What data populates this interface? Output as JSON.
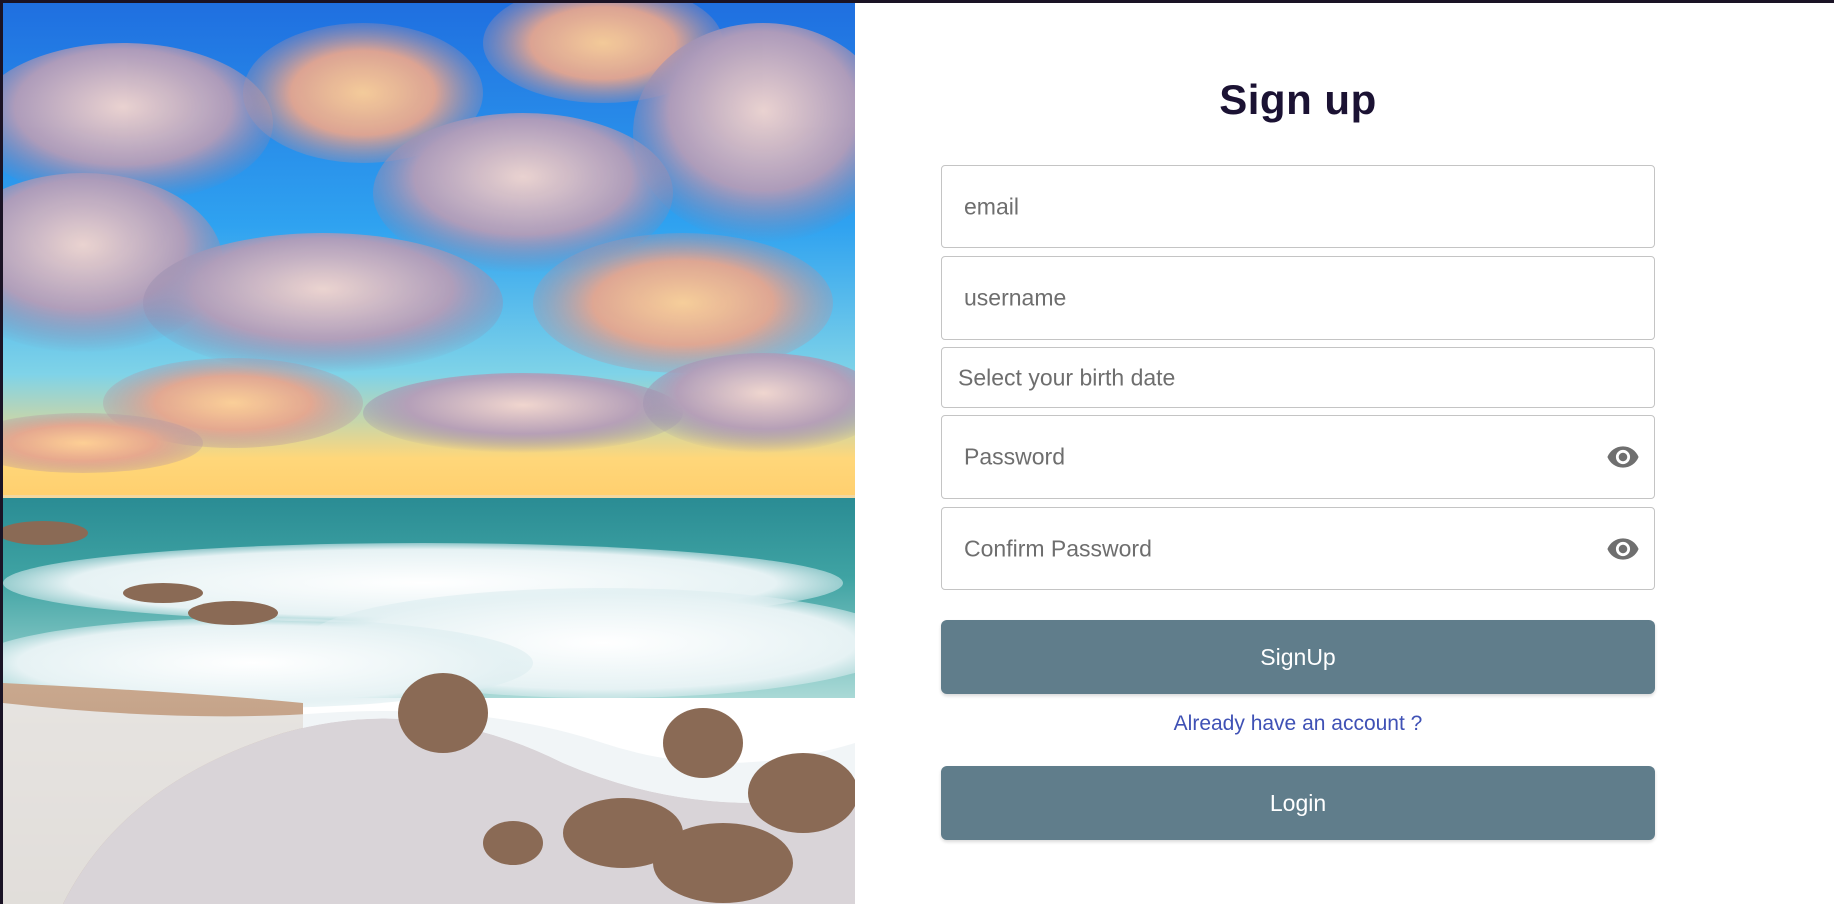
{
  "form": {
    "title": "Sign up",
    "email_placeholder": "email",
    "username_placeholder": "username",
    "birthdate_placeholder": "Select your birth date",
    "password_placeholder": "Password",
    "confirm_password_placeholder": "Confirm Password",
    "signup_label": "SignUp",
    "already_account_link": "Already have an account ?",
    "login_label": "Login"
  },
  "icons": {
    "password_toggle": "eye-icon",
    "confirm_password_toggle": "eye-icon"
  },
  "colors": {
    "button_bg": "#607d8b",
    "title": "#1b1233",
    "link": "#3f51b5"
  }
}
